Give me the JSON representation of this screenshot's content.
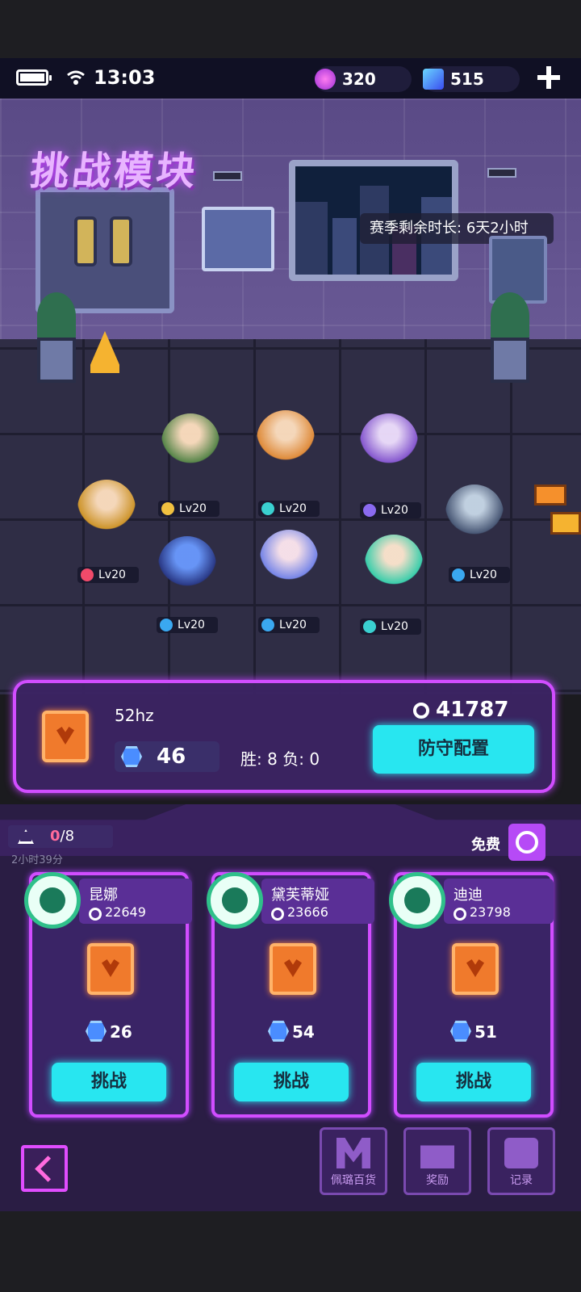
{
  "status": {
    "time": "13:03"
  },
  "resources": [
    {
      "value": "320"
    },
    {
      "value": "515"
    }
  ],
  "scene": {
    "title": "挑战模块",
    "season_label": "赛季剩余时长:",
    "season_value": "6天2小时"
  },
  "characters": [
    {
      "level": "Lv20"
    },
    {
      "level": "Lv20"
    },
    {
      "level": "Lv20"
    },
    {
      "level": "Lv20"
    },
    {
      "level": "Lv20"
    },
    {
      "level": "Lv20"
    },
    {
      "level": "Lv20"
    },
    {
      "level": "Lv20"
    },
    {
      "level": "Lv20"
    }
  ],
  "player": {
    "name": "52hz",
    "gems": "46",
    "win_label": "胜:",
    "wins": "8",
    "loss_label": "负:",
    "losses": "0",
    "power": "41787",
    "defense_button": "防守配置"
  },
  "attempts": {
    "count": "0",
    "max": "/8",
    "timer": "2小时39分",
    "free_label": "免费"
  },
  "opponents": [
    {
      "name": "昆娜",
      "power": "22649",
      "gems": "26",
      "button": "挑战"
    },
    {
      "name": "黛芙蒂娅",
      "power": "23666",
      "gems": "54",
      "button": "挑战"
    },
    {
      "name": "迪迪",
      "power": "23798",
      "gems": "51",
      "button": "挑战"
    }
  ],
  "nav": [
    {
      "label": "佩璐百货"
    },
    {
      "label": "奖励"
    },
    {
      "label": "记录"
    }
  ],
  "colors": {
    "accent": "#d14dff",
    "button": "#28e6f0",
    "panel": "#3c2464",
    "attempt_count": "#ff6b9b"
  }
}
